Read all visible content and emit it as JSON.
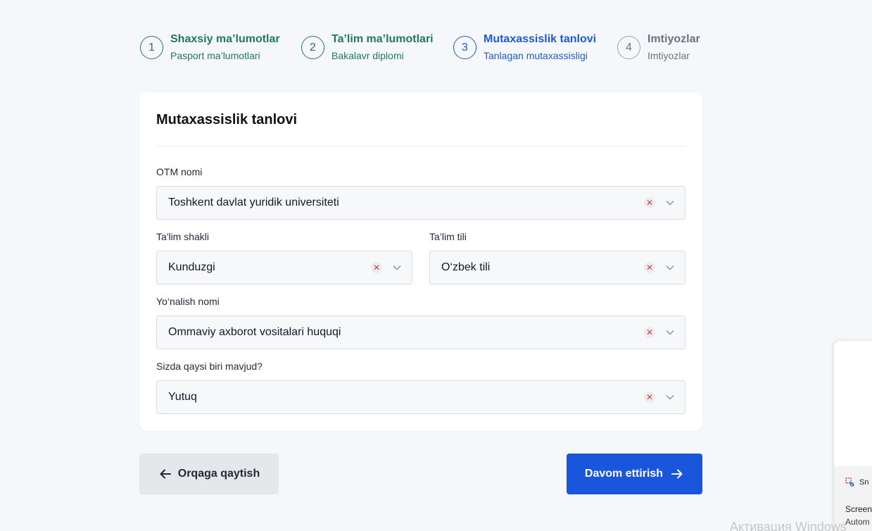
{
  "stepper": {
    "steps": [
      {
        "number": "1",
        "title": "Shaxsiy ma’lumotlar",
        "subtitle": "Pasport ma’lumotlari",
        "state": "done"
      },
      {
        "number": "2",
        "title": "Ta’lim ma’lumotlari",
        "subtitle": "Bakalavr diplomi",
        "state": "done"
      },
      {
        "number": "3",
        "title": "Mutaxassislik tanlovi",
        "subtitle": "Tanlagan mutaxassisligi",
        "state": "active"
      },
      {
        "number": "4",
        "title": "Imtiyozlar",
        "subtitle": "Imtiyozlar",
        "state": "pending"
      }
    ]
  },
  "card": {
    "title": "Mutaxassislik tanlovi",
    "fields": {
      "otm": {
        "label": "OTM nomi",
        "value": "Toshkent davlat yuridik universiteti"
      },
      "talim_shakli": {
        "label": "Ta'lim shakli",
        "value": "Kunduzgi"
      },
      "talim_tili": {
        "label": "Ta’lim tili",
        "value": "O‘zbek tili"
      },
      "yonalish": {
        "label": "Yo‘nalish nomi",
        "value": "Ommaviy axborot vositalari huquqi"
      },
      "mavjud": {
        "label": "Sizda qaysi biri mavjud?",
        "value": "Yutuq"
      }
    }
  },
  "buttons": {
    "back_label": "Orqaga qaytish",
    "next_label": "Davom ettirish"
  },
  "overlay": {
    "app_label": "Sn",
    "line1": "Screen",
    "line2": "Autom"
  },
  "watermark": "Активация Windows",
  "colors": {
    "done": "#1f7a5a",
    "active": "#1d5ad8",
    "pending": "#6b7280",
    "primary_button": "#1a56db",
    "secondary_button": "#e6e7ea"
  },
  "icons": {
    "clear": "close-x-icon",
    "chevron": "chevron-down-icon",
    "back": "arrow-left-icon",
    "next": "arrow-right-icon"
  }
}
